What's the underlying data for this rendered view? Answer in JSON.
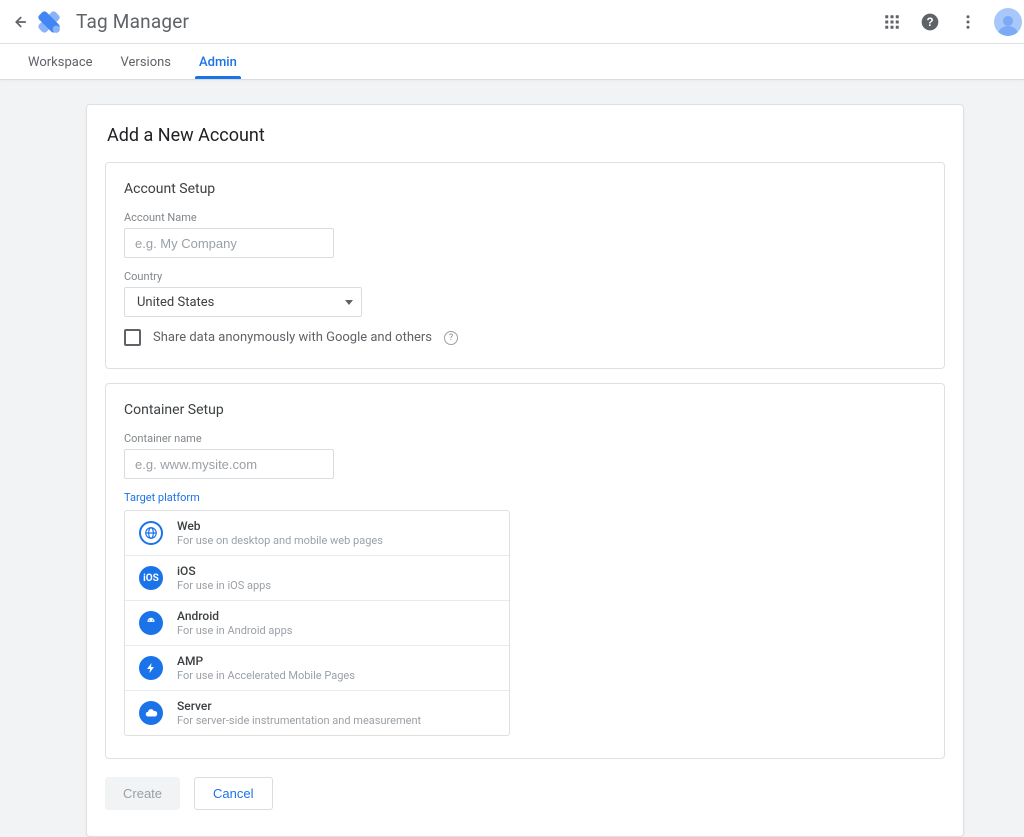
{
  "app": {
    "title": "Tag Manager"
  },
  "tabs": {
    "workspace": "Workspace",
    "versions": "Versions",
    "admin": "Admin"
  },
  "page": {
    "title": "Add a New Account"
  },
  "account_setup": {
    "title": "Account Setup",
    "name_label": "Account Name",
    "name_placeholder": "e.g. My Company",
    "country_label": "Country",
    "country_value": "United States",
    "share_text": "Share data anonymously with Google and others",
    "help_glyph": "?"
  },
  "container_setup": {
    "title": "Container Setup",
    "name_label": "Container name",
    "name_placeholder": "e.g. www.mysite.com",
    "target_label": "Target platform",
    "platforms": [
      {
        "key": "web",
        "title": "Web",
        "sub": "For use on desktop and mobile web pages",
        "icon": "globe",
        "style": "outline"
      },
      {
        "key": "ios",
        "title": "iOS",
        "sub": "For use in iOS apps",
        "icon": "ios",
        "style": "solid"
      },
      {
        "key": "android",
        "title": "Android",
        "sub": "For use in Android apps",
        "icon": "android",
        "style": "solid"
      },
      {
        "key": "amp",
        "title": "AMP",
        "sub": "For use in Accelerated Mobile Pages",
        "icon": "bolt",
        "style": "solid"
      },
      {
        "key": "server",
        "title": "Server",
        "sub": "For server-side instrumentation and measurement",
        "icon": "cloud",
        "style": "solid"
      }
    ]
  },
  "actions": {
    "create": "Create",
    "cancel": "Cancel"
  }
}
